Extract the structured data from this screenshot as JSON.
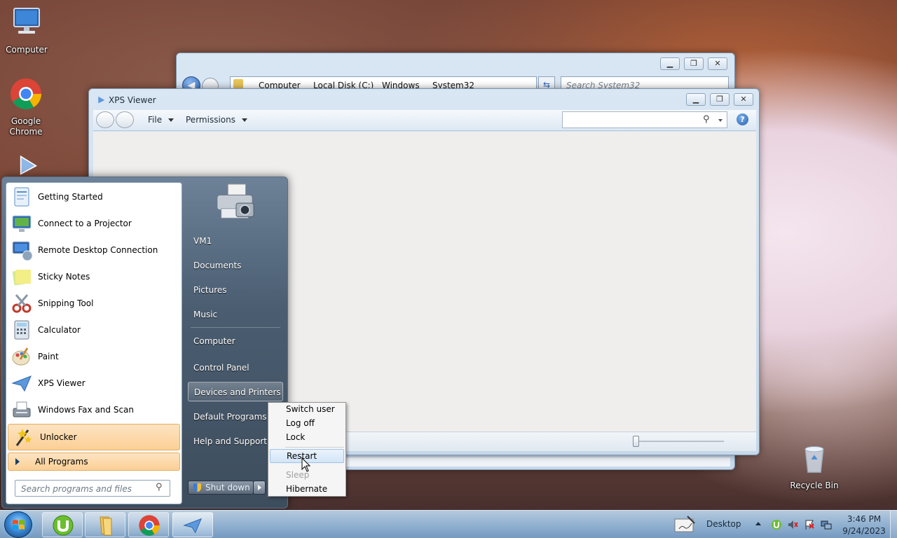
{
  "desktop": {
    "icons": [
      {
        "label": "Computer",
        "icon": "computer-icon"
      },
      {
        "label": "Google Chrome",
        "icon": "chrome-icon"
      },
      {
        "label": "",
        "icon": "xps-viewer-shortcut-icon"
      },
      {
        "label": "Recycle Bin",
        "icon": "recycle-bin-icon"
      }
    ]
  },
  "explorer": {
    "breadcrumb": [
      "Computer",
      "Local Disk (C:)",
      "Windows",
      "System32"
    ],
    "search_placeholder": "Search System32",
    "caption_buttons": [
      "minimize",
      "maximize",
      "close"
    ]
  },
  "xps_viewer": {
    "title": "XPS Viewer",
    "menu": [
      {
        "label": "File"
      },
      {
        "label": "Permissions"
      }
    ],
    "search_value": "",
    "help_label": "?"
  },
  "start_menu": {
    "programs": [
      {
        "label": "Getting Started",
        "icon": "getting-started-icon"
      },
      {
        "label": "Connect to a Projector",
        "icon": "projector-icon"
      },
      {
        "label": "Remote Desktop Connection",
        "icon": "remote-desktop-icon"
      },
      {
        "label": "Sticky Notes",
        "icon": "sticky-notes-icon"
      },
      {
        "label": "Snipping Tool",
        "icon": "snipping-tool-icon"
      },
      {
        "label": "Calculator",
        "icon": "calculator-icon"
      },
      {
        "label": "Paint",
        "icon": "paint-icon"
      },
      {
        "label": "XPS Viewer",
        "icon": "xps-viewer-icon"
      },
      {
        "label": "Windows Fax and Scan",
        "icon": "fax-scan-icon"
      },
      {
        "label": "Unlocker",
        "icon": "unlocker-icon"
      }
    ],
    "all_programs": "All Programs",
    "search_placeholder": "Search programs and files",
    "right_items": [
      "VM1",
      "Documents",
      "Pictures",
      "Music",
      "Computer",
      "Control Panel",
      "Devices and Printers",
      "Default Programs",
      "Help and Support"
    ],
    "shutdown_label": "Shut down",
    "power_menu": [
      {
        "label": "Switch user",
        "enabled": true
      },
      {
        "label": "Log off",
        "enabled": true
      },
      {
        "label": "Lock",
        "enabled": true
      },
      {
        "label": "Restart",
        "enabled": true,
        "highlighted": true
      },
      {
        "label": "Sleep",
        "enabled": false
      },
      {
        "label": "Hibernate",
        "enabled": true
      }
    ]
  },
  "taskbar": {
    "pinned": [
      "utorrent-icon",
      "file-explorer-icon",
      "chrome-icon",
      "xps-viewer-icon"
    ],
    "desktop_label": "Desktop",
    "time": "3:46 PM",
    "date": "9/24/2023"
  },
  "colors": {
    "highlight_orange": "#fbd6a7",
    "menu_hover": "#d8e8f8",
    "start_right_panel": "#3d4d5d"
  }
}
